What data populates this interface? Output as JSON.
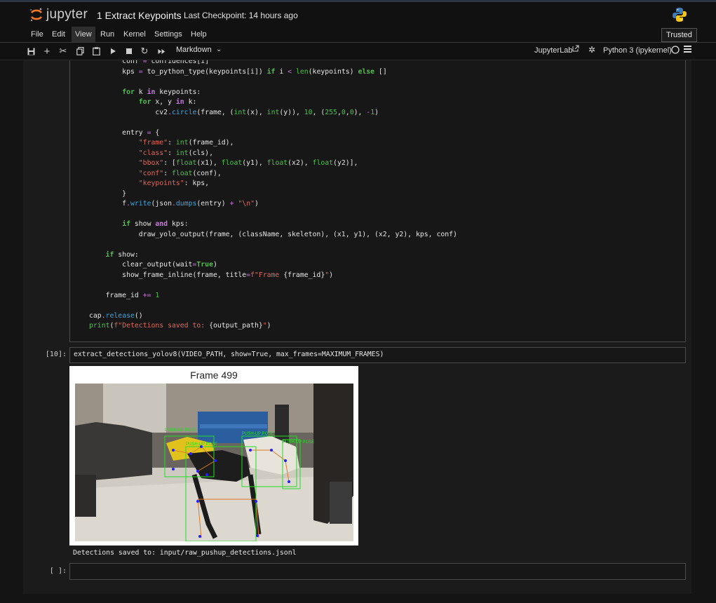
{
  "app": {
    "logo_text": "jupyter",
    "notebook_title": "1 Extract Keypoints",
    "checkpoint": "Last Checkpoint: 14 hours ago"
  },
  "menu": {
    "items": [
      "File",
      "Edit",
      "View",
      "Run",
      "Kernel",
      "Settings",
      "Help"
    ],
    "active": "View",
    "trusted": "Trusted"
  },
  "toolbar": {
    "cell_type": "Markdown",
    "jupyterlab_label": "JupyterLab",
    "kernel_label": "Python 3 (ipykernel)",
    "icons": [
      "save-icon",
      "add-cell-icon",
      "cut-icon",
      "copy-icon",
      "paste-icon",
      "run-icon",
      "stop-icon",
      "restart-icon",
      "run-all-icon"
    ]
  },
  "cells": [
    {
      "prompt": "",
      "type": "code",
      "lines": [
        "        conf = confidences[i]",
        "        kps = to_python_type(keypoints[i]) if i < len(keypoints) else []",
        "",
        "        for k in keypoints:",
        "            for x, y in k:",
        "                cv2.circle(frame, (int(x), int(y)), 10, (255,0,0), -1)",
        "",
        "        entry = {",
        "            \"frame\": int(frame_id),",
        "            \"class\": int(cls),",
        "            \"bbox\": [float(x1), float(y1), float(x2), float(y2)],",
        "            \"conf\": float(conf),",
        "            \"keypoints\": kps,",
        "        }",
        "        f.write(json.dumps(entry) + \"\\n\")",
        "",
        "        if show and kps:",
        "            draw_yolo_output(frame, (className, skeleton), (x1, y1), (x2, y2), kps, conf)",
        "",
        "    if show:",
        "        clear_output(wait=True)",
        "        show_frame_inline(frame, title=f\"Frame {frame_id}\")",
        "",
        "    frame_id += 1",
        "",
        "cap.release()",
        "print(f\"Detections saved to: {output_path}\")"
      ]
    },
    {
      "prompt": "[10]:",
      "type": "code",
      "source": "extract_detections_yolov8(VIDEO_PATH, show=True, max_frames=MAXIMUM_FRAMES)",
      "figure_title": "Frame 499",
      "overlay_labels": [
        "PUSH-UP POSE",
        "PUSH-UP POSE",
        "PUSH-UP POSE",
        "PUSH-UP POSE"
      ],
      "stdout": "Detections saved to: input/raw_pushup_detections.jsonl"
    },
    {
      "prompt": "[ ]:",
      "type": "code",
      "source": ""
    }
  ]
}
